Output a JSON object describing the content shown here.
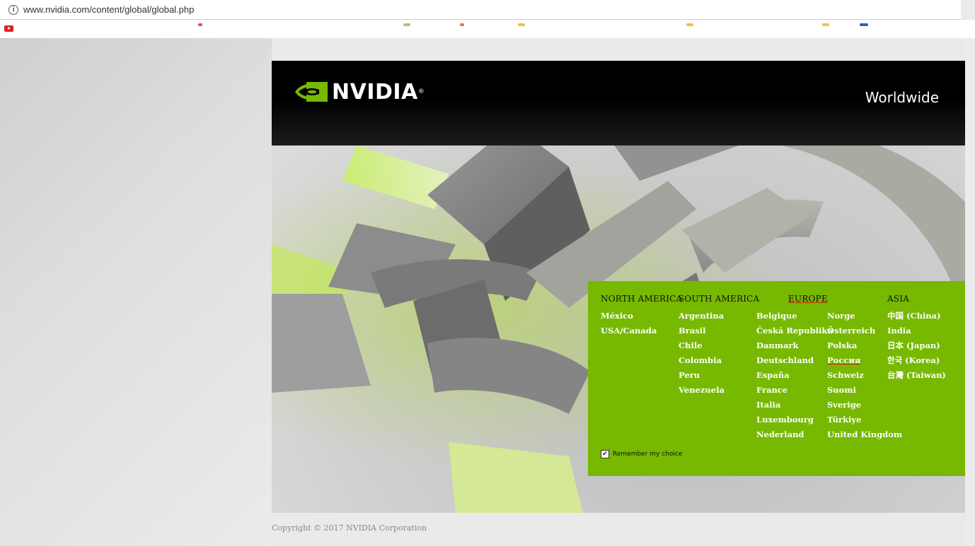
{
  "browser": {
    "url": "www.nvidia.com/content/global/global.php",
    "info_icon": "info-icon"
  },
  "header": {
    "logo_text": "NVIDIA",
    "logo_mark": "®",
    "title": "Worldwide",
    "brand_color": "#76b900"
  },
  "regions": [
    {
      "name": "NORTH AMERICA",
      "countries": [
        "México",
        "USA/Canada"
      ]
    },
    {
      "name": "SOUTH AMERICA",
      "countries": [
        "Argentina",
        "Brasil",
        "Chile",
        "Colombia",
        "Peru",
        "Venezuela"
      ]
    },
    {
      "name": "EUROPE",
      "countries": [
        "Belgique",
        "Česká Republika",
        "Danmark",
        "Deutschland",
        "España",
        "France",
        "Italia",
        "Luxembourg",
        "Nederland"
      ],
      "countries_2": [
        "Norge",
        "Österreich",
        "Polska",
        "Россия",
        "Schweiz",
        "Suomi",
        "Sverige",
        "Türkiye",
        "United Kingdom"
      ]
    },
    {
      "name": "ASIA",
      "countries": [
        "中国 (China)",
        "India",
        "日本 (Japan)",
        "한국 (Korea)",
        "台灣 (Taiwan)"
      ]
    }
  ],
  "remember": {
    "label": "Remember my choice",
    "checked": true
  },
  "footer": {
    "copyright": "Copyright © 2017 NVIDIA Corporation"
  }
}
